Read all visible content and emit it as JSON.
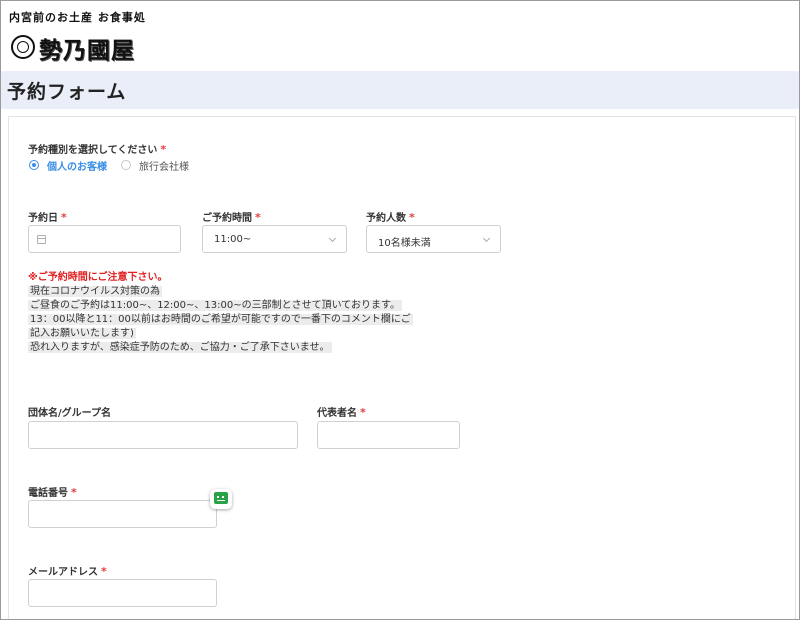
{
  "header": {
    "tagline": "内宮前のお土産 お食事処",
    "shop_name": "勢乃國屋"
  },
  "page": {
    "title": "予約フォーム"
  },
  "form": {
    "reservation_type": {
      "label": "予約種別を選択してください",
      "required_mark": "*",
      "options": [
        {
          "label": "個人のお客様",
          "selected": true
        },
        {
          "label": "旅行会社様",
          "selected": false
        }
      ]
    },
    "date": {
      "label": "予約日",
      "required_mark": "*",
      "value": ""
    },
    "time": {
      "label": "ご予約時間",
      "required_mark": "*",
      "value": "11:00~"
    },
    "party_size": {
      "label": "予約人数",
      "required_mark": "*",
      "value": "10名様未満"
    },
    "notice": {
      "title": "※ご予約時間にご注意下さい。",
      "lines": [
        "現在コロナウイルス対策の為",
        "ご昼食のご予約は11:00~、12:00~、13:00~の三部制とさせて頂いております。",
        "13：00以降と11：00以前はお時間のご希望が可能ですので一番下のコメント欄にご",
        "記入お願いいたします)",
        "恐れ入りますが、感染症予防のため、ご協力・ご了承下さいませ。"
      ]
    },
    "group_name": {
      "label": "団体名/グループ名",
      "value": ""
    },
    "representative": {
      "label": "代表者名",
      "required_mark": "*",
      "value": ""
    },
    "phone": {
      "label": "電話番号",
      "required_mark": "*",
      "value": ""
    },
    "email": {
      "label": "メールアドレス",
      "required_mark": "*",
      "value": ""
    }
  },
  "icons": {
    "calendar": "calendar-icon",
    "chevron": "chevron-down-icon",
    "helper": "autofill-icon"
  },
  "colors": {
    "accent": "#3a8ee6",
    "required": "#e04040",
    "notice_title": "#e02020",
    "title_bar": "#e9eef9",
    "helper_green": "#29a345"
  }
}
